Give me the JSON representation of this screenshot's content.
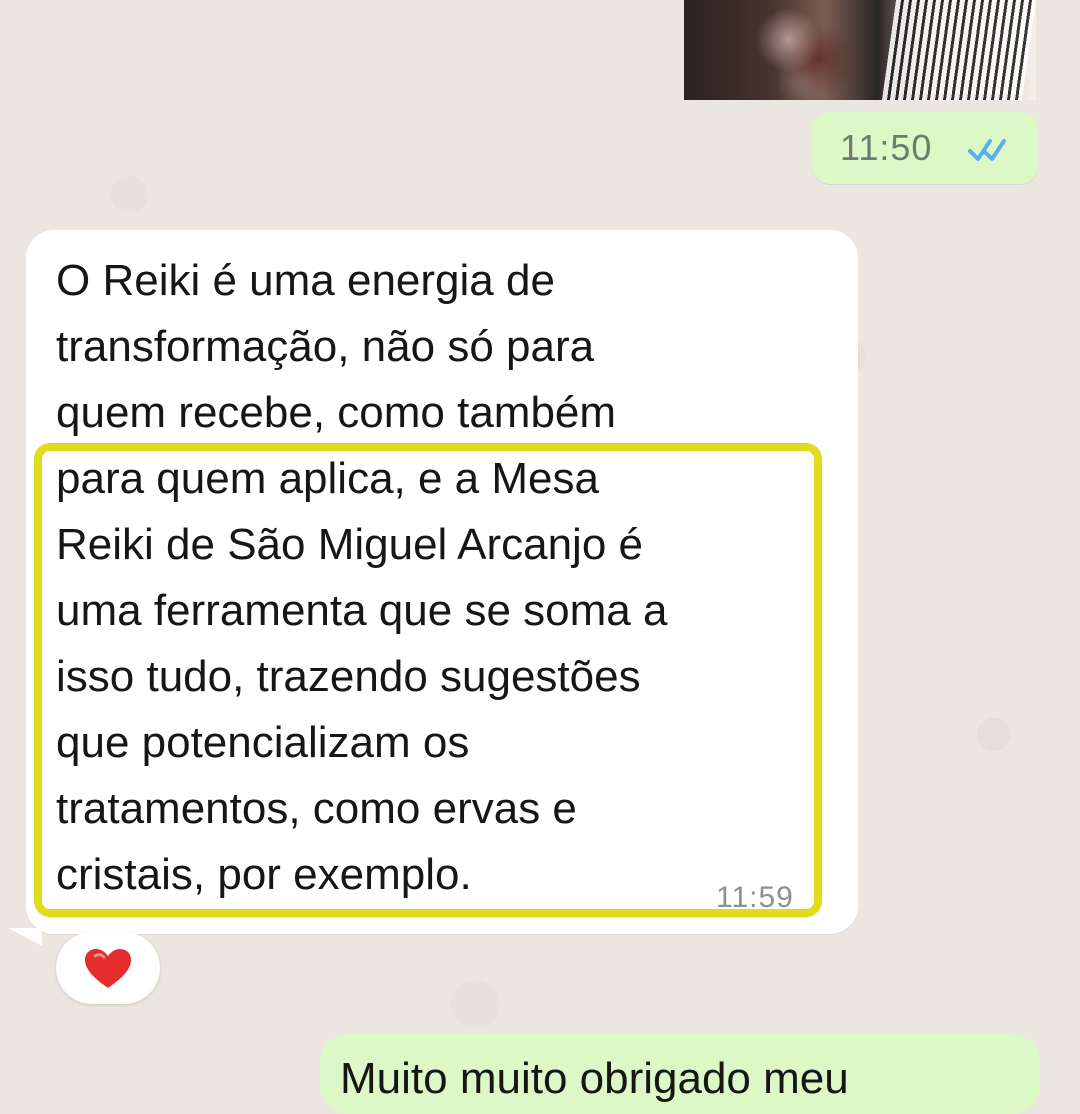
{
  "chat": {
    "sent_media_time": "11:50",
    "incoming_message": "O Reiki é uma energia de\ntransformação, não só para\nquem recebe, como também\npara quem aplica, e a Mesa\nReiki de São Miguel Arcanjo é\numa ferramenta que se soma a\nisso tudo, trazendo sugestões\nque potencializam os\ntratamentos, como ervas e\ncristais, por exemplo.",
    "incoming_time": "11:59",
    "reaction_icon": "heart-icon",
    "bottom_preview_text": "Muito muito obrigado meu"
  },
  "colors": {
    "background": "#ebe6df",
    "incoming_bubble": "#ffffff",
    "outgoing_bubble": "#dcf8c6",
    "highlight": "#e0db1d",
    "read_receipt": "#56b0ef",
    "heart": "#e52c2c"
  }
}
